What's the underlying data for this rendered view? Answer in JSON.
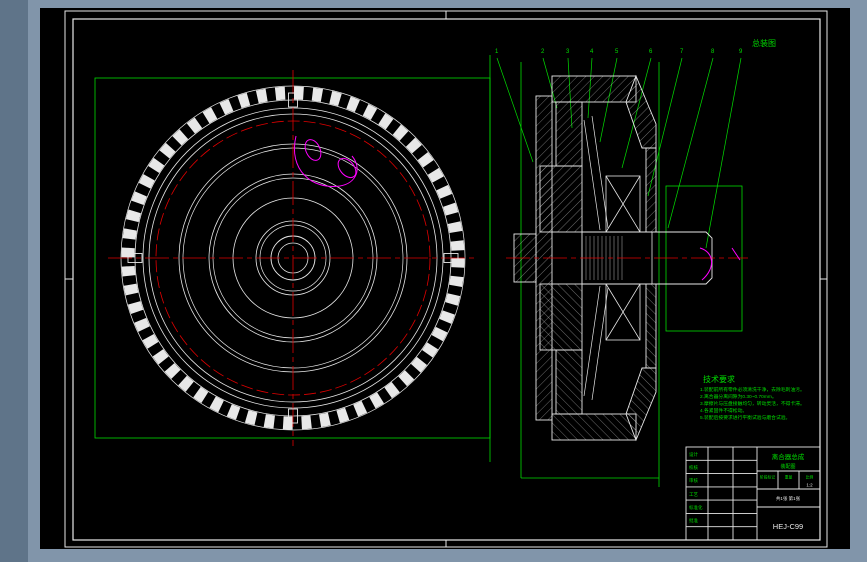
{
  "canvas": {
    "bg_outer": "#8195aa",
    "bg_strip": "#5f7489",
    "bg_drawing": "#000000",
    "line_color": "#e8e8e8",
    "center_color": "#e00000",
    "annotation_color": "#00dd00",
    "detail_color": "#ff00ff"
  },
  "corner_note": "总装图",
  "leader_labels": [
    "1",
    "2",
    "3",
    "4",
    "5",
    "6",
    "7",
    "8",
    "9"
  ],
  "tech_requirements": {
    "title": "技术要求",
    "lines": [
      "1.装配前所有零件必须清洗干净，去除毛刺油污。",
      "2.离合器分离间隙为0.30~0.70mm。",
      "3.摩擦片与压盘接触均匀，转动灵活，不得卡滞。",
      "4.各紧固件不得松动。",
      "5.装配后按要求进行平衡试验与磨合试验。"
    ]
  },
  "title_block": {
    "rows": [
      "设计",
      "校核",
      "审核",
      "工艺",
      "标准化",
      "批准"
    ],
    "part_name": "离合器总成",
    "drawing_type": "装配图",
    "headers": [
      "阶段标记",
      "重量",
      "比例"
    ],
    "scale": "1:2",
    "sheet_info": "共1张 第1张",
    "drawing_no": "HEJ-C99"
  }
}
